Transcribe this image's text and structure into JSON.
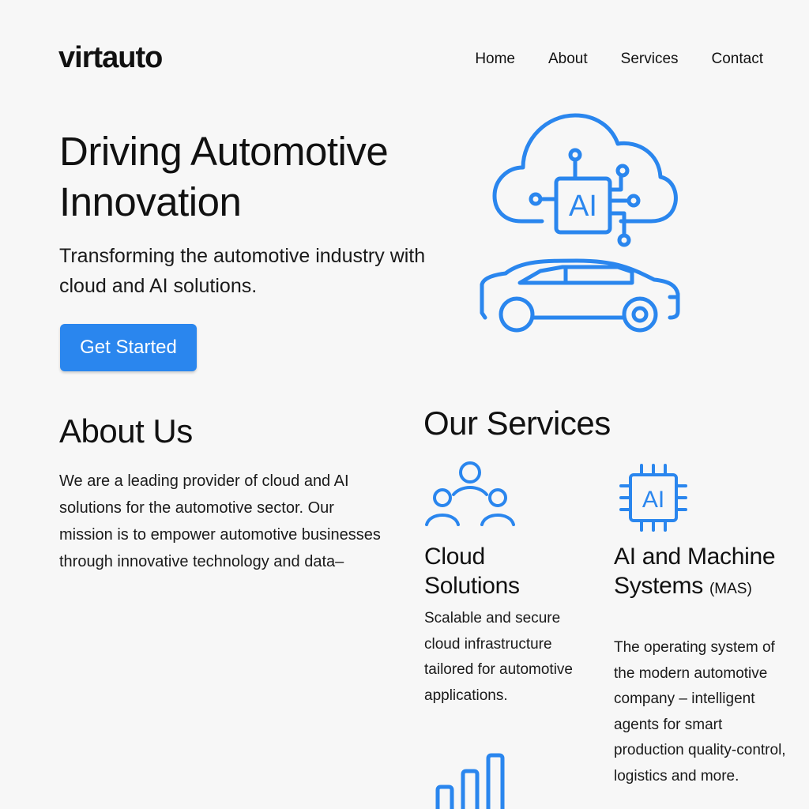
{
  "brand": {
    "name": "virtauto"
  },
  "nav": {
    "items": [
      "Home",
      "About",
      "Services",
      "Contact"
    ]
  },
  "hero": {
    "title": "Driving Automotive Innovation",
    "subtitle": "Transforming the automotive industry with cloud and AI solutions.",
    "cta_label": "Get Started",
    "chip_label": "AI"
  },
  "about": {
    "title": "About Us",
    "body": "We are a leading provider of cloud and AI solutions for the automotive sector. Our mission is to empower automotive businesses through innovative technology and data–"
  },
  "services": {
    "title": "Our Services",
    "items": [
      {
        "name": "Cloud Solutions",
        "description": "Scalable and secure cloud infrastructure tailored for automotive applications.",
        "icon": "people-network-icon"
      },
      {
        "name": "AI and Machine Systems",
        "suffix": "(MAS)",
        "description": "The operating system of the modern automotive company – intelligent agents for smart production quality-control, logistics and more.",
        "icon": "ai-chip-icon",
        "chip_label": "AI"
      }
    ]
  },
  "colors": {
    "accent": "#2a86ee",
    "text": "#111111",
    "background": "#f7f7f7"
  },
  "icons": [
    "cloud-ai-icon",
    "car-icon",
    "people-network-icon",
    "ai-chip-icon",
    "bar-chart-icon"
  ]
}
